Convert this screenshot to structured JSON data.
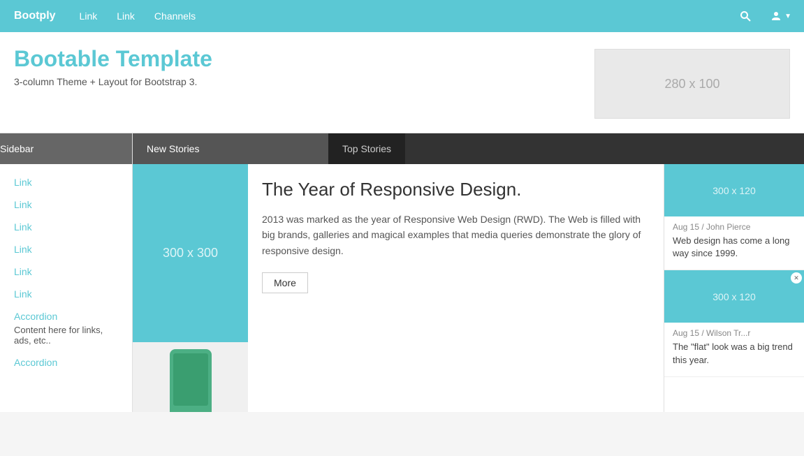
{
  "navbar": {
    "brand": "Bootply",
    "links": [
      "Link",
      "Link",
      "Channels"
    ],
    "search_icon": "🔍",
    "user_icon": "👤"
  },
  "hero": {
    "title": "Bootable Template",
    "subtitle": "3-column Theme + Layout for Bootstrap 3.",
    "ad_size": "280 x 100"
  },
  "tabs": {
    "sidebar": "Sidebar",
    "new_stories": "New Stories",
    "top_stories": "Top Stories"
  },
  "sidebar": {
    "links": [
      "Link",
      "Link",
      "Link",
      "Link",
      "Link",
      "Link"
    ],
    "accordion1_title": "Accordion",
    "accordion1_content": "Content here for links, ads, etc..",
    "accordion2_title": "Accordion"
  },
  "article": {
    "title": "The Year of Responsive Design.",
    "description": "2013 was marked as the year of Responsive Web Design (RWD). The Web is filled with big brands, galleries and magical examples that media queries demonstrate the glory of responsive design.",
    "more_button": "More",
    "image_300_label": "300 x 300"
  },
  "right_column": {
    "thumb1_label": "300 x 120",
    "story1_meta": "Aug 15 / John Pierce",
    "story1_text": "Web design has come a long way since 1999.",
    "thumb2_label": "300 x 120",
    "story2_meta": "Aug 15 / Wilson Tr...r",
    "story2_text": "The \"flat\" look was a big trend this year."
  }
}
